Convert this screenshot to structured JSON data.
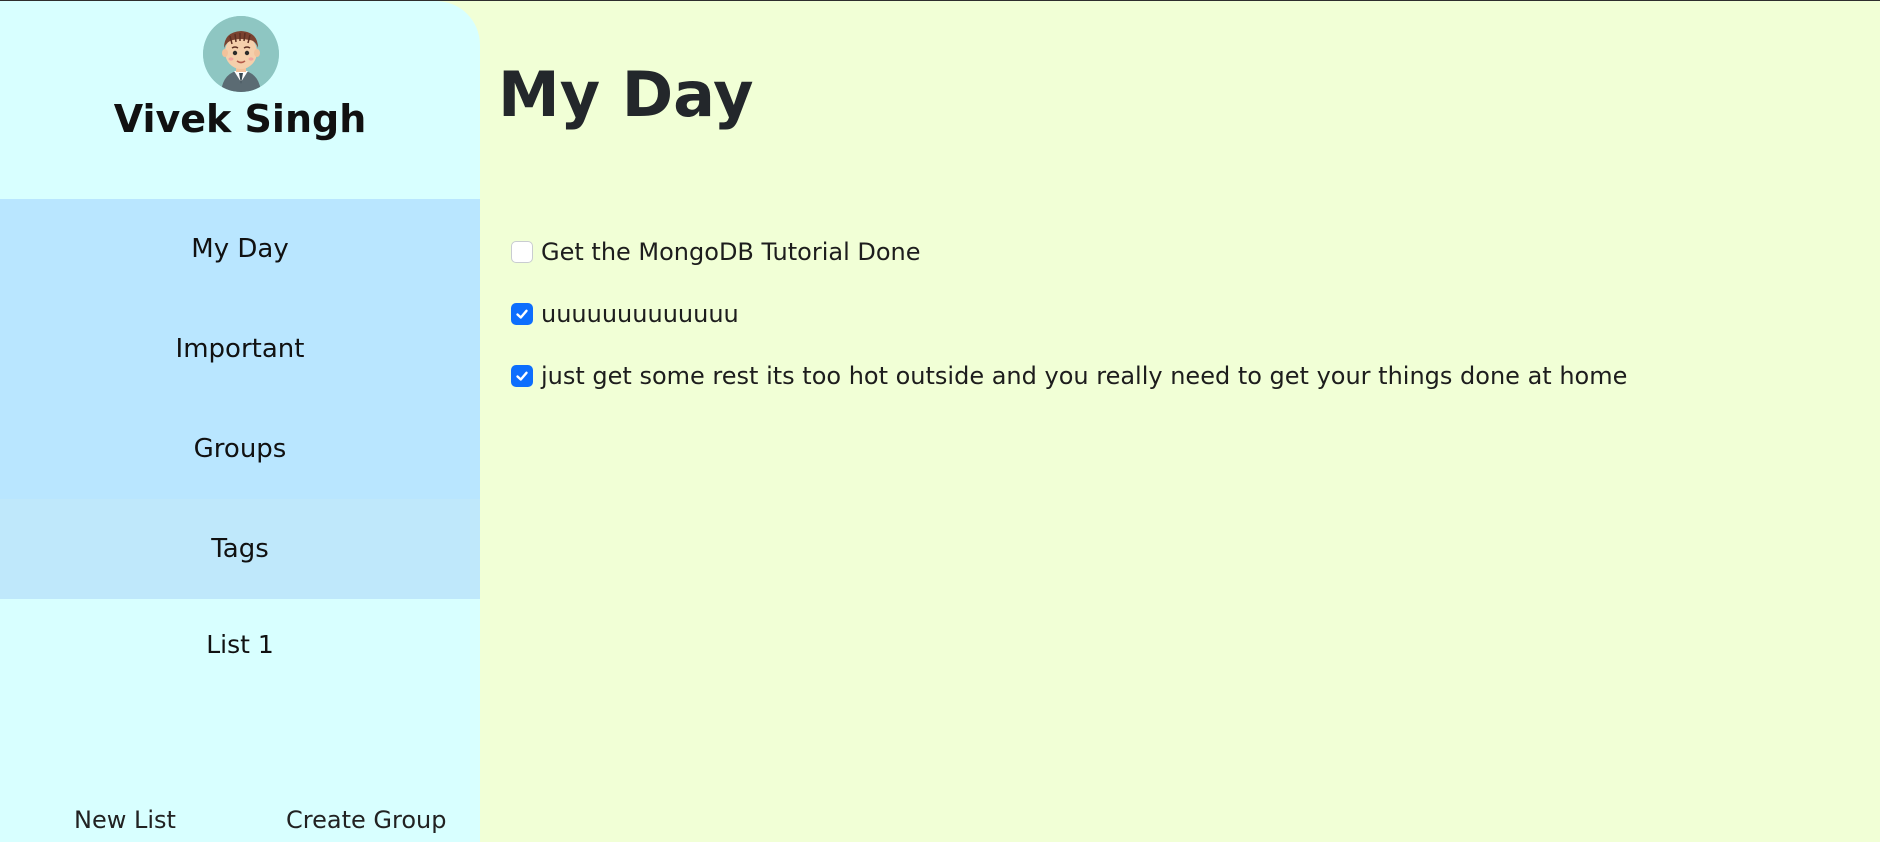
{
  "user": {
    "name": "Vivek Singh"
  },
  "nav": {
    "items": [
      {
        "label": "My Day"
      },
      {
        "label": "Important"
      },
      {
        "label": "Groups"
      },
      {
        "label": "Tags"
      }
    ]
  },
  "lists": [
    {
      "label": "List 1"
    }
  ],
  "footer": {
    "new_list_label": "New List",
    "create_group_label": "Create Group"
  },
  "main": {
    "title": "My Day",
    "tasks": [
      {
        "text": "Get the MongoDB Tutorial Done",
        "completed": false
      },
      {
        "text": "uuuuuuuuuuuuu",
        "completed": true
      },
      {
        "text": "just get some rest its too hot outside and you really need to get your things done at home",
        "completed": true
      }
    ]
  },
  "colors": {
    "page_background": "#f1ffd6",
    "sidebar_background": "#d8ffff",
    "nav_background": "#b9e6ff",
    "checkbox_accent": "#0d6efd"
  }
}
